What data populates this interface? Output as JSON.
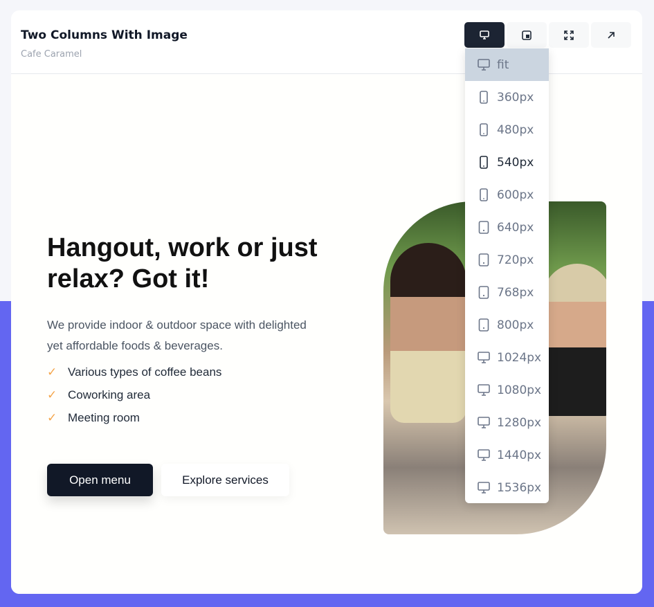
{
  "header": {
    "title": "Two Columns With Image",
    "subtitle": "Cafe Caramel"
  },
  "toolbar": [
    {
      "name": "viewport-button",
      "icon": "monitor-icon",
      "active": true
    },
    {
      "name": "code-button",
      "icon": "ts-file-icon"
    },
    {
      "name": "fullscreen-button",
      "icon": "expand-icon"
    },
    {
      "name": "open-new-button",
      "icon": "arrow-up-right-icon"
    }
  ],
  "dropdown": {
    "items": [
      {
        "label": "fit",
        "icon": "monitor"
      },
      {
        "label": "360px",
        "icon": "phone"
      },
      {
        "label": "480px",
        "icon": "phone"
      },
      {
        "label": "540px",
        "icon": "phone"
      },
      {
        "label": "600px",
        "icon": "phone"
      },
      {
        "label": "640px",
        "icon": "tablet"
      },
      {
        "label": "720px",
        "icon": "tablet"
      },
      {
        "label": "768px",
        "icon": "tablet"
      },
      {
        "label": "800px",
        "icon": "tablet"
      },
      {
        "label": "1024px",
        "icon": "monitor"
      },
      {
        "label": "1080px",
        "icon": "monitor"
      },
      {
        "label": "1280px",
        "icon": "monitor"
      },
      {
        "label": "1440px",
        "icon": "monitor"
      },
      {
        "label": "1536px",
        "icon": "monitor"
      }
    ],
    "selected": "fit",
    "hovered": "540px"
  },
  "hero": {
    "heading": "Hangout, work or just relax? Got it!",
    "lead": "We provide indoor & outdoor space with delighted yet affordable foods & beverages.",
    "features": [
      "Various types of coffee beans",
      "Coworking area",
      "Meeting room"
    ],
    "primary_button": "Open menu",
    "secondary_button": "Explore services"
  }
}
